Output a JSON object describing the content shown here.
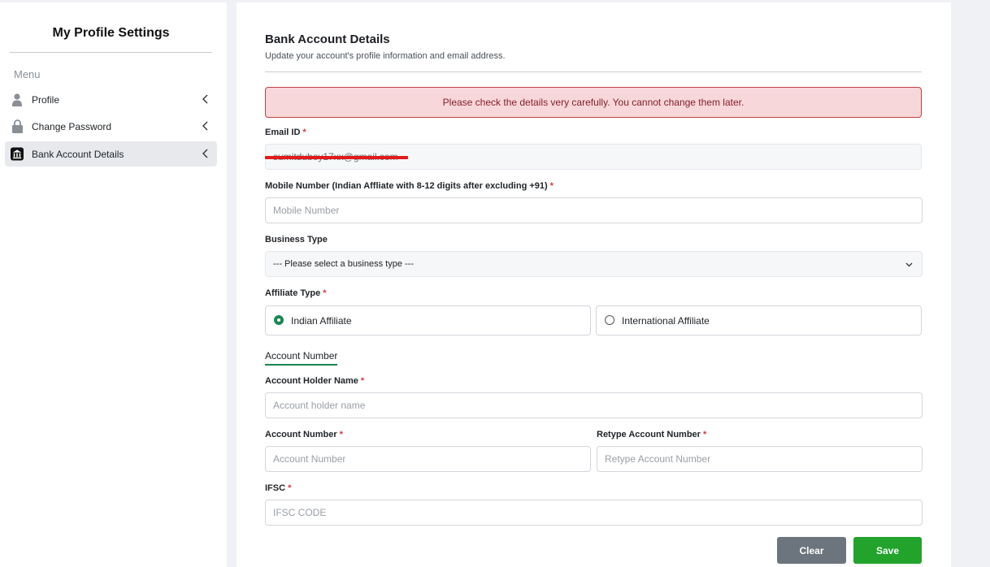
{
  "sidebar": {
    "title": "My Profile Settings",
    "menu_label": "Menu",
    "items": [
      {
        "label": "Profile",
        "icon": "user-icon"
      },
      {
        "label": "Change Password",
        "icon": "lock-icon"
      },
      {
        "label": "Bank Account Details",
        "icon": "bank-icon",
        "active": true
      }
    ]
  },
  "main": {
    "title": "Bank Account Details",
    "subtitle": "Update your account's profile information and email address.",
    "alert": "Please check the details very carefully. You cannot change them later.",
    "email": {
      "label": "Email ID",
      "value": "sumitdubey17xx@gmail.com",
      "redacted": true
    },
    "mobile": {
      "label": "Mobile Number (Indian Affliate with 8-12 digits after excluding +91)",
      "placeholder": "Mobile Number"
    },
    "business": {
      "label": "Business Type",
      "selected": "--- Please select a business type ---"
    },
    "affiliate": {
      "label": "Affiliate Type",
      "options": [
        {
          "label": "Indian Affiliate",
          "checked": true
        },
        {
          "label": "International Affiliate",
          "checked": false
        }
      ]
    },
    "tab_label": "Account Number",
    "holder": {
      "label": "Account Holder Name",
      "placeholder": "Account holder name"
    },
    "account_number": {
      "label": "Account Number",
      "placeholder": "Account Number"
    },
    "retype": {
      "label": "Retype Account Number",
      "placeholder": "Retype Account Number"
    },
    "ifsc": {
      "label": "IFSC",
      "placeholder": "IFSC CODE"
    },
    "buttons": {
      "clear": "Clear",
      "save": "Save"
    },
    "required_mark": "*"
  },
  "colors": {
    "accent_green": "#21a32c",
    "radio_green": "#198754",
    "alert_bg": "#f8d7da",
    "alert_border": "#c2413f",
    "required": "#dc3545",
    "clear_button": "#6c757d",
    "redaction": "#e11a1a"
  }
}
